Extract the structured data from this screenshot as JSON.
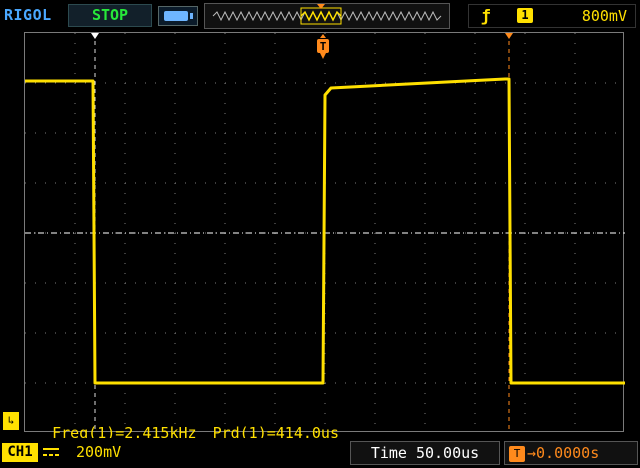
{
  "top_bar": {
    "brand": "RIGOL",
    "run_state": "STOP",
    "trigger_source_channel": "1",
    "trigger_level": "800mV"
  },
  "icons": {
    "memory": "memory-depth-icon",
    "overview": "waveform-overview-icon",
    "trigger_edge": "rising-edge-icon",
    "trigger_marker": "trigger-position-icon",
    "ground_marker": "channel-ground-icon",
    "coupling": "dc-coupling-icon"
  },
  "measurements": {
    "frequency": "Freq(1)=2.415kHz",
    "period": "Prd(1)=414.0us"
  },
  "bottom_bar": {
    "channel_label": "CH1",
    "vertical_scale": "200mV",
    "timebase": "Time 50.00us",
    "trigger_offset": "0.0000s",
    "trigger_offset_icon_label": "T"
  },
  "colors": {
    "ch1": "#ffe000",
    "trigger": "#ff8a1c",
    "run_state": "#27e83a",
    "brand": "#4aa8ff",
    "grid": "#7a7a7a"
  },
  "waveform": {
    "type": "square",
    "high_level_left": "≈ +3.8 div",
    "low_level": "≈ -3.8 div",
    "duty_cycle": 0.5
  }
}
